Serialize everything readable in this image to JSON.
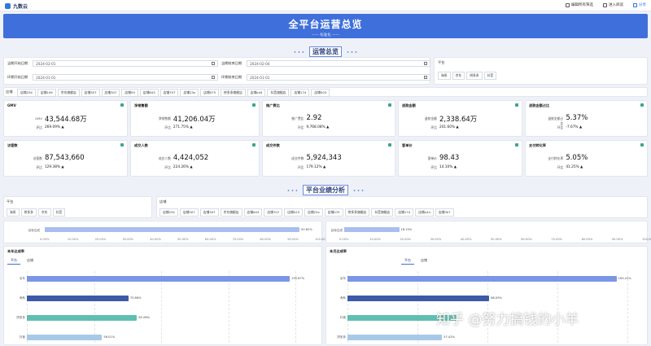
{
  "topbar": {
    "app_name": "九数云",
    "actions": [
      "编辑所有筛选",
      "进入阅读",
      "分享"
    ]
  },
  "banner": {
    "title": "全平台运营总览",
    "subtitle": "—— 标准化 ——"
  },
  "section1_title": "运营总览",
  "section2_title": "平台业绩分析",
  "filters": {
    "current_start_label": "当期开始日期",
    "current_start_value": "2024-02-01",
    "current_end_label": "当期结束日期",
    "current_end_value": "2024-02-04",
    "compare_start_label": "环期开始日期",
    "compare_start_value": "2024-01-01",
    "compare_end_label": "环期结束日期",
    "compare_end_value": "2024-01-01",
    "platform_label": "平台",
    "platform_options": [
      "淘系",
      "京东",
      "拼多多",
      "抖音"
    ]
  },
  "shop_label": "店铺",
  "shops": [
    "店铺234",
    "店铺109",
    "京东旗舰店",
    "店铺307",
    "店铺307",
    "店铺93",
    "店铺643",
    "店铺707",
    "店铺23x",
    "店铺075",
    "拼多多旗舰店",
    "店铺x44",
    "抖音旗舰店",
    "店铺174",
    "店铺503"
  ],
  "shops2": [
    "店铺234",
    "店铺307",
    "店铺307",
    "京东旗舰店",
    "店铺643",
    "店铺707",
    "店铺023",
    "店铺23x",
    "店铺075",
    "拼多多旗舰店",
    "抖音旗舰店",
    "店铺174",
    "店铺x44",
    "店铺307"
  ],
  "metrics": [
    {
      "label": "GMV",
      "main_name": "GMV",
      "main_value": "43,544.68万",
      "pct_name": "环比",
      "pct_value": "269.09% ▲"
    },
    {
      "label": "净销售额",
      "main_name": "净销售额",
      "main_value": "41,206.04万",
      "pct_name": "环比",
      "pct_value": "271.75% ▲"
    },
    {
      "label": "推广费比",
      "main_name": "推广费比",
      "main_value": "2.92",
      "pct_name": "环比",
      "pct_value": "9,768.08% ▲"
    },
    {
      "label": "退款金额",
      "main_name": "退款金额",
      "main_value": "2,338.64万",
      "pct_name": "环比",
      "pct_value": "241.60% ▲"
    },
    {
      "label": "退款金额占比",
      "main_name": "退款金额占比",
      "main_value": "5.37%",
      "pct_name": "环比",
      "pct_value": "-7.67% ▲"
    },
    {
      "label": "访客数",
      "main_name": "访客数",
      "main_value": "87,543,660",
      "pct_name": "环比",
      "pct_value": "129.38% ▲"
    },
    {
      "label": "成交人数",
      "main_name": "成交人数",
      "main_value": "4,424,052",
      "pct_name": "环比",
      "pct_value": "224.26% ▲"
    },
    {
      "label": "成交件数",
      "main_name": "成交件数",
      "main_value": "5,924,343",
      "pct_name": "环比",
      "pct_value": "179.12% ▲"
    },
    {
      "label": "客单价",
      "main_name": "客单价",
      "main_value": "98.43",
      "pct_name": "环比",
      "pct_value": "14.10% ▲"
    },
    {
      "label": "支付转化率",
      "main_name": "支付转化率",
      "main_value": "5.05%",
      "pct_name": "环比",
      "pct_value": "41.25% ▲"
    }
  ],
  "platform_filter_label": "平台",
  "platform_filter_options": [
    "淘系",
    "拼多多",
    "京东",
    "抖音"
  ],
  "shop_filter_label": "店铺",
  "progress_left": {
    "label": "目标达成",
    "value": 0.9262,
    "value_text": "92.62%"
  },
  "progress_right": {
    "label": "目标达成",
    "value": 0.1815,
    "value_text": "18.15%"
  },
  "progress_ticks": [
    "0.00%",
    "10.00%",
    "20.00%",
    "30.00%",
    "40.00%",
    "50.00%",
    "60.00%",
    "70.00%",
    "80.00%",
    "90.00%",
    "100.00%"
  ],
  "chart_data": [
    {
      "type": "bar",
      "title": "本年达成率",
      "tabs": [
        "平台",
        "店铺"
      ],
      "categories": [
        "京东",
        "淘系",
        "拼多多",
        "抖音"
      ],
      "values": [
        195.87,
        75.66,
        82.06,
        56.01
      ],
      "labels": [
        "195.87%",
        "75.66%",
        "82.06%",
        "56.01%"
      ],
      "colors": [
        "#7b96e6",
        "#3d5aa8",
        "#5fbfb0",
        "#a8c8e8"
      ]
    },
    {
      "type": "bar",
      "title": "本月达成率",
      "tabs": [
        "平台",
        "店铺"
      ],
      "categories": [
        "京东",
        "淘系",
        "抖音",
        "拼多多"
      ],
      "values": [
        163.41,
        86.09,
        66.41,
        57.42
      ],
      "labels": [
        "163.41%",
        "86.09%",
        "",
        "57.42%"
      ],
      "colors": [
        "#7b96e6",
        "#3d5aa8",
        "#5fbfb0",
        "#a8c8e8"
      ]
    }
  ],
  "watermark": "知乎 @努力搞钱的小羊"
}
